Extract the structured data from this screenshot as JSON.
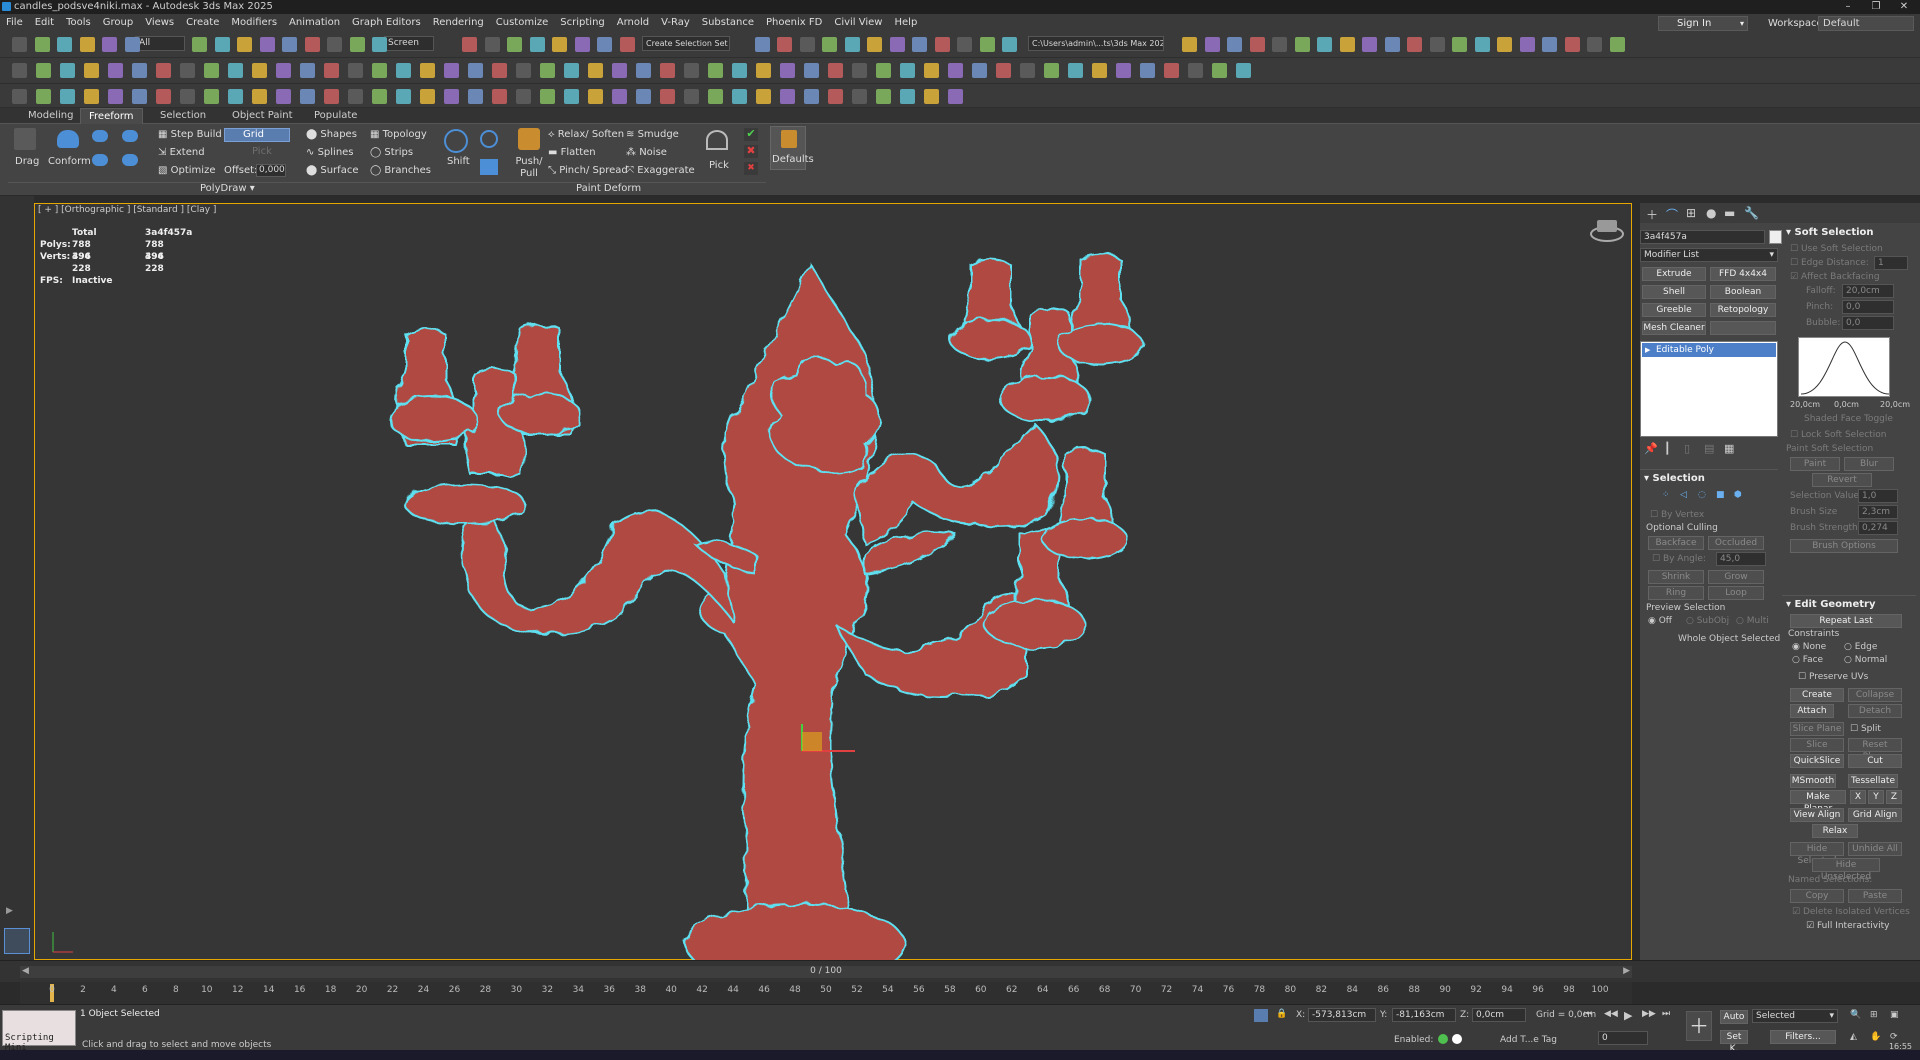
{
  "titlebar": {
    "title": "candles_podsve4niki.max - Autodesk 3ds Max 2025"
  },
  "menu": [
    "File",
    "Edit",
    "Tools",
    "Group",
    "Views",
    "Create",
    "Modifiers",
    "Animation",
    "Graph Editors",
    "Rendering",
    "Customize",
    "Scripting",
    "Arnold",
    "V-Ray",
    "Substance",
    "Phoenix FD",
    "Civil View",
    "Help"
  ],
  "account": {
    "sign_in": "Sign In",
    "workspaces_label": "Workspaces:",
    "workspace": "Default"
  },
  "toolbar": {
    "selection_filter": "All",
    "coord_system": "Screen",
    "named_selection": "Create Selection Set",
    "project_path": "C:\\Users\\admin\\...ts\\3ds Max 2025"
  },
  "ribbon": {
    "tabs": [
      "Modeling",
      "Freeform",
      "Selection",
      "Object Paint",
      "Populate"
    ],
    "active_tab": "Freeform",
    "drag": "Drag",
    "conform": "Conform",
    "step_build": "Step Build",
    "extend": "Extend",
    "optimize": "Optimize",
    "grid": "Grid",
    "pick_disabled": "Pick",
    "offset_label": "Offset:",
    "offset_value": "0,000",
    "shapes": "Shapes",
    "splines": "Splines",
    "surface": "Surface",
    "topology": "Topology",
    "strips": "Strips",
    "branches": "Branches",
    "shift": "Shift",
    "push_pull": "Push/ Pull",
    "relax_soften": "Relax/ Soften",
    "flatten": "Flatten",
    "pinch_spread": "Pinch/ Spread",
    "smudge": "Smudge",
    "noise": "Noise",
    "exaggerate": "Exaggerate",
    "pick": "Pick",
    "defaults": "Defaults",
    "group_polydraw": "PolyDraw",
    "group_paint_deform": "Paint Deform"
  },
  "viewport": {
    "label": "[ + ] [Orthographic ] [Standard ] [Clay ]",
    "stats_total": "Total",
    "stats_object": "3a4f457a",
    "polys_label": "Polys:",
    "polys_total": "788 496",
    "polys_object": "788 496",
    "verts_label": "Verts:",
    "verts_total": "394 228",
    "verts_object": "394 228",
    "fps_label": "FPS:",
    "fps_value": "Inactive",
    "model_color": "#b04a42",
    "outline_color": "#5fe0f0"
  },
  "command_panel": {
    "object_name": "3a4f457a",
    "modifier_list": "Modifier List",
    "buttons": [
      "Extrude",
      "FFD 4x4x4",
      "Shell",
      "Boolean",
      "Greeble",
      "Retopology",
      "Mesh Cleaner",
      ""
    ],
    "stack_item": "Editable Poly",
    "selection": {
      "title": "Selection",
      "by_vertex": "By Vertex",
      "optional_culling": "Optional Culling",
      "backface": "Backface",
      "occluded": "Occluded",
      "by_angle": "By Angle:",
      "by_angle_value": "45,0",
      "shrink": "Shrink",
      "grow": "Grow",
      "ring": "Ring",
      "loop": "Loop",
      "preview_selection": "Preview Selection",
      "off": "Off",
      "subobj": "SubObj",
      "multi": "Multi",
      "status": "Whole Object Selected"
    },
    "soft_selection": {
      "title": "Soft Selection",
      "use_soft": "Use Soft Selection",
      "edge_distance": "Edge Distance:",
      "edge_distance_value": "1",
      "affect_backfacing": "Affect Backfacing",
      "falloff": "Falloff:",
      "falloff_value": "20,0cm",
      "pinch": "Pinch:",
      "pinch_value": "0,0",
      "bubble": "Bubble:",
      "bubble_value": "0,0",
      "curve_left": "20,0cm",
      "curve_mid": "0,0cm",
      "curve_right": "20,0cm",
      "shaded_face_toggle": "Shaded Face Toggle",
      "lock_soft": "Lock Soft Selection",
      "paint_soft": "Paint Soft Selection",
      "paint": "Paint",
      "blur": "Blur",
      "revert": "Revert",
      "selection_value": "Selection Value",
      "selection_value_num": "1,0",
      "brush_size": "Brush Size",
      "brush_size_value": "2,3cm",
      "brush_strength": "Brush Strength",
      "brush_strength_value": "0,274",
      "brush_options": "Brush Options"
    },
    "edit_geometry": {
      "title": "Edit Geometry",
      "repeat_last": "Repeat Last",
      "constraints": "Constraints",
      "none": "None",
      "edge": "Edge",
      "face": "Face",
      "normal": "Normal",
      "preserve_uvs": "Preserve UVs",
      "create": "Create",
      "collapse": "Collapse",
      "attach": "Attach",
      "detach": "Detach",
      "slice_plane": "Slice Plane",
      "split": "Split",
      "slice": "Slice",
      "reset_plane": "Reset Plane",
      "quickslice": "QuickSlice",
      "cut": "Cut",
      "msmooth": "MSmooth",
      "tessellate": "Tessellate",
      "make_planar": "Make Planar",
      "x": "X",
      "y": "Y",
      "z": "Z",
      "view_align": "View Align",
      "grid_align": "Grid Align",
      "relax": "Relax",
      "hide_selected": "Hide Selected",
      "unhide_all": "Unhide All",
      "hide_unselected": "Hide Unselected",
      "named_selections": "Named Selections:",
      "copy": "Copy",
      "paste": "Paste",
      "delete_isolated": "Delete Isolated Vertices",
      "full_interactivity": "Full Interactivity"
    }
  },
  "timeline": {
    "frame_counter": "0 / 100",
    "ticks": [
      "0",
      "2",
      "4",
      "6",
      "8",
      "10",
      "12",
      "14",
      "16",
      "18",
      "20",
      "22",
      "24",
      "26",
      "28",
      "30",
      "32",
      "34",
      "36",
      "38",
      "40",
      "42",
      "44",
      "46",
      "48",
      "50",
      "52",
      "54",
      "56",
      "58",
      "60",
      "62",
      "64",
      "66",
      "68",
      "70",
      "72",
      "74",
      "76",
      "78",
      "80",
      "82",
      "84",
      "86",
      "88",
      "90",
      "92",
      "94",
      "96",
      "98",
      "100"
    ]
  },
  "status": {
    "script_label": "Scripting Mini",
    "objects_selected": "1 Object Selected",
    "prompt": "Click and drag to select and move objects",
    "x_label": "X:",
    "x_value": "-573,813cm",
    "y_label": "Y:",
    "y_value": "-81,163cm",
    "z_label": "Z:",
    "z_value": "0,0cm",
    "grid": "Grid = 0,0cm",
    "enabled": "Enabled:",
    "add_time_tag": "Add T...e Tag",
    "auto": "Auto",
    "set_key": "Set K.",
    "selected_dropdown": "Selected",
    "filters": "Filters...",
    "frame_field": "0",
    "clock": "16:55"
  }
}
